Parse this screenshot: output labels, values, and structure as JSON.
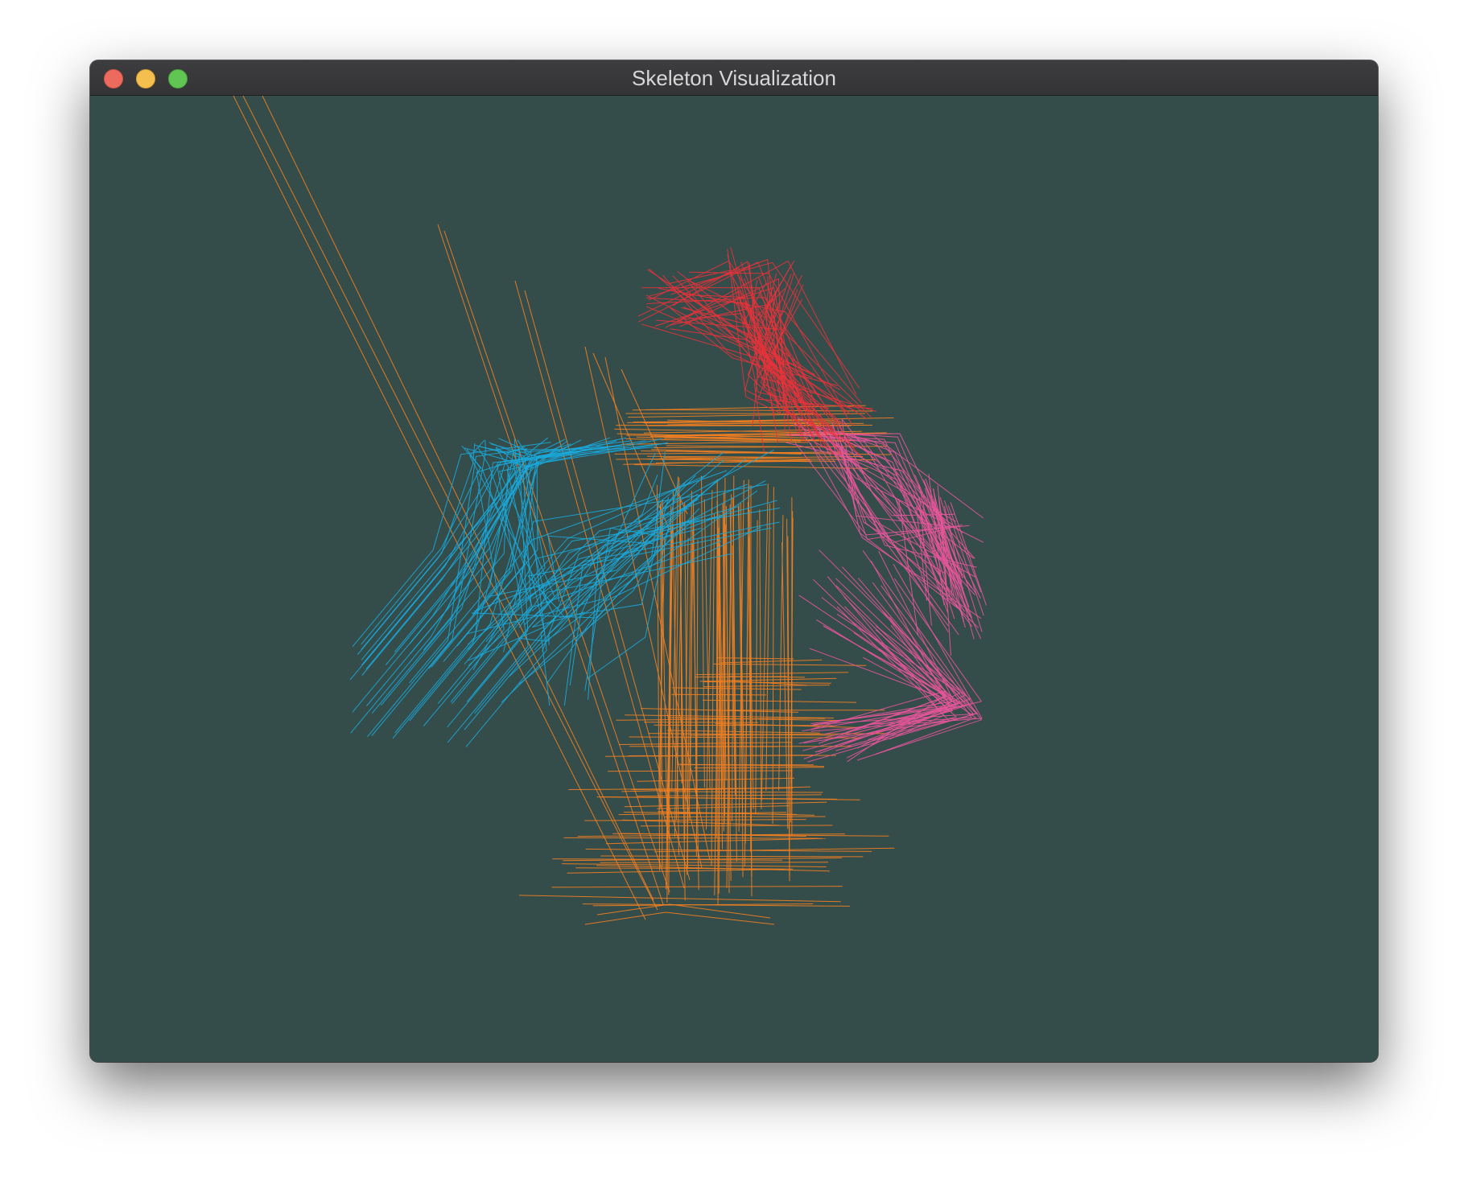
{
  "window": {
    "title": "Skeleton Visualization"
  },
  "canvas": {
    "background": "#344d4b"
  },
  "colors": {
    "head": "#e8323a",
    "left_arm": "#1aa9dc",
    "right_arm": "#e8559a",
    "legs": "#f47f20",
    "window_close": "#ed6a5e",
    "window_minimize": "#f4bf4f",
    "window_maximize": "#61c554"
  }
}
